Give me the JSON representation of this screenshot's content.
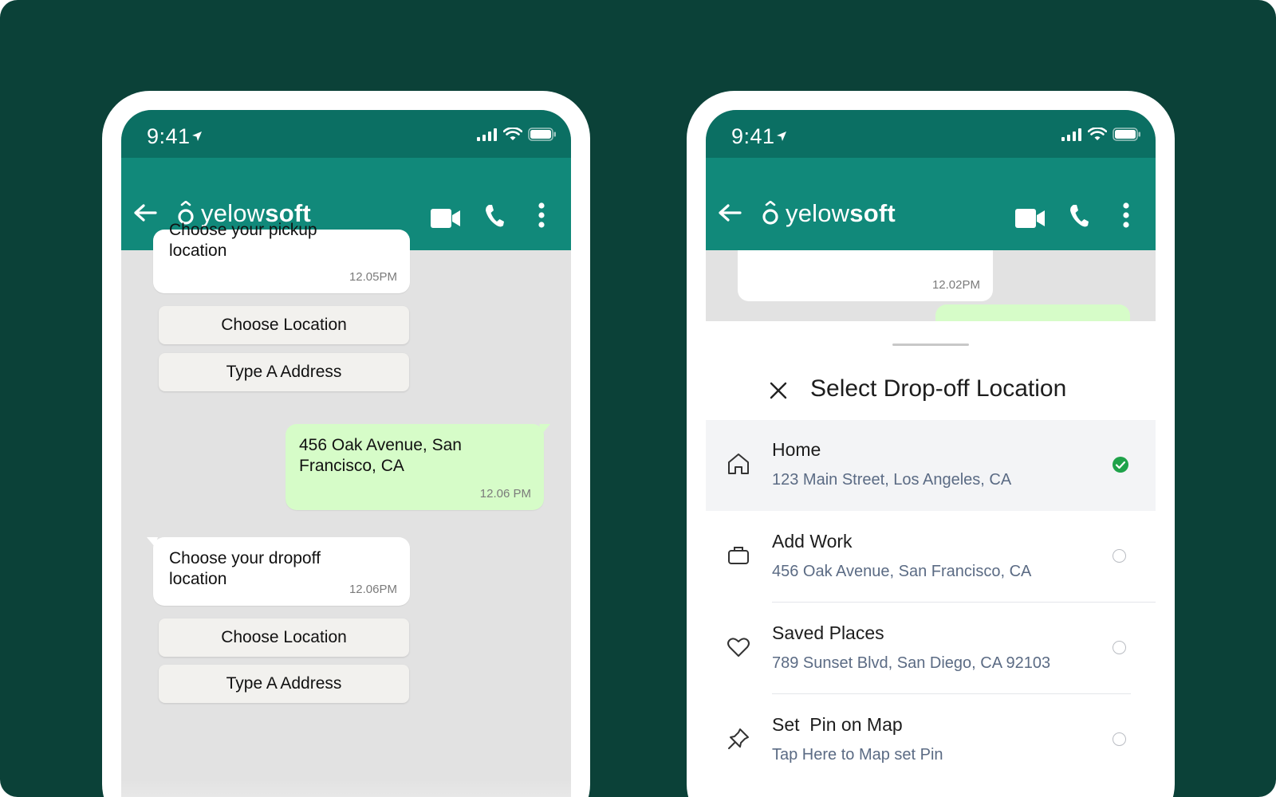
{
  "status_bar": {
    "time": "9:41"
  },
  "brand": {
    "logo_regular": "yelow",
    "logo_bold": "soft"
  },
  "left_phone": {
    "top_message": {
      "line1": "Choose your pickup",
      "line2": "location",
      "time": "12.05PM"
    },
    "quick_replies_1": [
      "Choose Location",
      "Type A Address"
    ],
    "sent_message": {
      "line1": "456 Oak Avenue, San",
      "line2": "Francisco, CA",
      "time": "12.06 PM"
    },
    "dropoff_message": {
      "line1": "Choose your dropoff",
      "line2": "location",
      "time": "12.06PM"
    },
    "quick_replies_2": [
      "Choose Location",
      "Type A Address"
    ]
  },
  "right_phone": {
    "top_message_time": "12.02PM",
    "sheet": {
      "title": "Select Drop-off Location",
      "options": [
        {
          "name": "Home",
          "address": "123 Main Street, Los Angeles, CA",
          "icon": "home-icon",
          "selected": true
        },
        {
          "name": "Add Work",
          "address": "456 Oak Avenue, San Francisco, CA",
          "icon": "briefcase-icon",
          "selected": false
        },
        {
          "name": "Saved Places",
          "address": "789 Sunset Blvd, San Diego, CA 92103",
          "icon": "heart-icon",
          "selected": false
        },
        {
          "name": "Set  Pin on Map",
          "address": "Tap Here to Map set Pin",
          "icon": "pin-icon",
          "selected": false
        }
      ]
    }
  },
  "colors": {
    "background": "#0b4138",
    "status_bar": "#0b6f63",
    "header": "#11897a",
    "incoming_bubble": "#ffffff",
    "outgoing_bubble": "#d6fcc8",
    "selected_check": "#1fa24a"
  }
}
